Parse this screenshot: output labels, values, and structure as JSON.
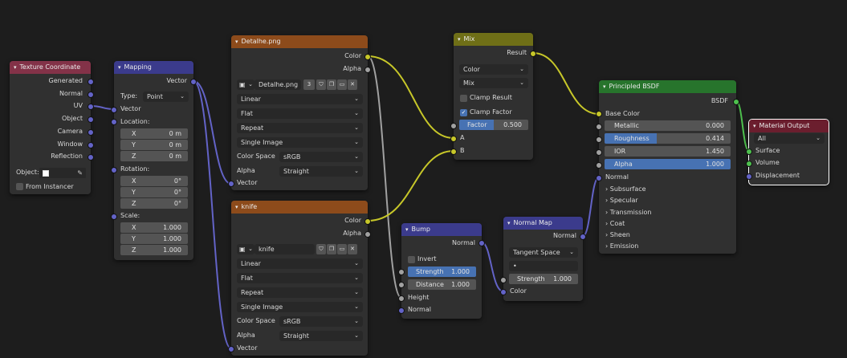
{
  "colors": {
    "background": "#1d1d1d",
    "input_header": "#833248",
    "vector_header": "#3b3b8c",
    "texture_header": "#8d4b1b",
    "color_header": "#6f6f17",
    "shader_header": "#27742c",
    "output_header": "#6b1e2e",
    "wire_color": "#c7c729",
    "wire_gray": "#a1a1a1",
    "wire_vector": "#6363c7",
    "wire_shader": "#4ec14e"
  },
  "texcoord": {
    "title": "Texture Coordinate",
    "outputs": [
      "Generated",
      "Normal",
      "UV",
      "Object",
      "Camera",
      "Window",
      "Reflection"
    ],
    "object_label": "Object:",
    "from_instancer": "From Instancer"
  },
  "mapping": {
    "title": "Mapping",
    "output": "Vector",
    "type_label": "Type:",
    "type_value": "Point",
    "vector_input": "Vector",
    "location_label": "Location:",
    "location": [
      {
        "axis": "X",
        "value": "0 m"
      },
      {
        "axis": "Y",
        "value": "0 m"
      },
      {
        "axis": "Z",
        "value": "0 m"
      }
    ],
    "rotation_label": "Rotation:",
    "rotation": [
      {
        "axis": "X",
        "value": "0°"
      },
      {
        "axis": "Y",
        "value": "0°"
      },
      {
        "axis": "Z",
        "value": "0°"
      }
    ],
    "scale_label": "Scale:",
    "scale": [
      {
        "axis": "X",
        "value": "1.000"
      },
      {
        "axis": "Y",
        "value": "1.000"
      },
      {
        "axis": "Z",
        "value": "1.000"
      }
    ]
  },
  "tex1": {
    "title": "Detalhe.png",
    "out_color": "Color",
    "out_alpha": "Alpha",
    "image_name": "Detalhe.png",
    "users": "3",
    "interpolation": "Linear",
    "projection": "Flat",
    "extension": "Repeat",
    "source": "Single Image",
    "color_space_label": "Color Space",
    "color_space": "sRGB",
    "alpha_label": "Alpha",
    "alpha_mode": "Straight",
    "vector_input": "Vector"
  },
  "tex2": {
    "title": "knife",
    "out_color": "Color",
    "out_alpha": "Alpha",
    "image_name": "knife",
    "interpolation": "Linear",
    "projection": "Flat",
    "extension": "Repeat",
    "source": "Single Image",
    "color_space_label": "Color Space",
    "color_space": "sRGB",
    "alpha_label": "Alpha",
    "alpha_mode": "Straight",
    "vector_input": "Vector"
  },
  "mix": {
    "title": "Mix",
    "output": "Result",
    "data_type": "Color",
    "blend_mode": "Mix",
    "clamp_result": "Clamp Result",
    "clamp_factor": "Clamp Factor",
    "factor_label": "Factor",
    "factor_value": "0.500",
    "input_a": "A",
    "input_b": "B"
  },
  "bump": {
    "title": "Bump",
    "output": "Normal",
    "invert": "Invert",
    "strength_label": "Strength",
    "strength_value": "1.000",
    "distance_label": "Distance",
    "distance_value": "1.000",
    "height": "Height",
    "normal": "Normal"
  },
  "normalmap": {
    "title": "Normal Map",
    "output": "Normal",
    "space": "Tangent Space",
    "uv_placeholder": "•",
    "strength_label": "Strength",
    "strength_value": "1.000",
    "color": "Color"
  },
  "bsdf": {
    "title": "Principled BSDF",
    "output": "BSDF",
    "base_color": "Base Color",
    "fields": [
      {
        "label": "Metallic",
        "value": "0.000"
      },
      {
        "label": "Roughness",
        "value": "0.414"
      },
      {
        "label": "IOR",
        "value": "1.450"
      },
      {
        "label": "Alpha",
        "value": "1.000"
      }
    ],
    "roughness_fill": 0.414,
    "normal": "Normal",
    "panels": [
      "Subsurface",
      "Specular",
      "Transmission",
      "Coat",
      "Sheen",
      "Emission"
    ]
  },
  "output": {
    "title": "Material Output",
    "target": "All",
    "inputs": [
      "Surface",
      "Volume",
      "Displacement"
    ]
  }
}
